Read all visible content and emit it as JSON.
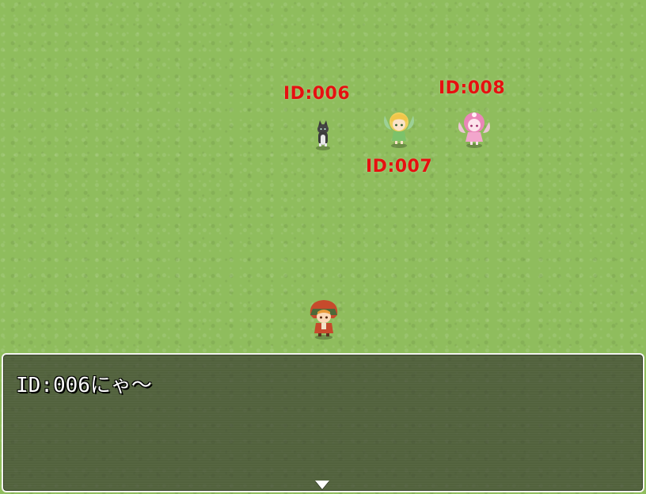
{
  "npcs": [
    {
      "id_label": "ID:006",
      "kind": "cat"
    },
    {
      "id_label": "ID:007",
      "kind": "fairy-yellow"
    },
    {
      "id_label": "ID:008",
      "kind": "fairy-pink"
    }
  ],
  "player": {
    "kind": "red-hood-girl"
  },
  "message": {
    "text": "ID:006にゃ～"
  },
  "colors": {
    "label": "#e61010",
    "grass": "#8fbd5d",
    "window_bg": "#3a3e30",
    "window_border": "#f4f4f0"
  },
  "icons": {
    "continue": "triangle-down-icon"
  }
}
